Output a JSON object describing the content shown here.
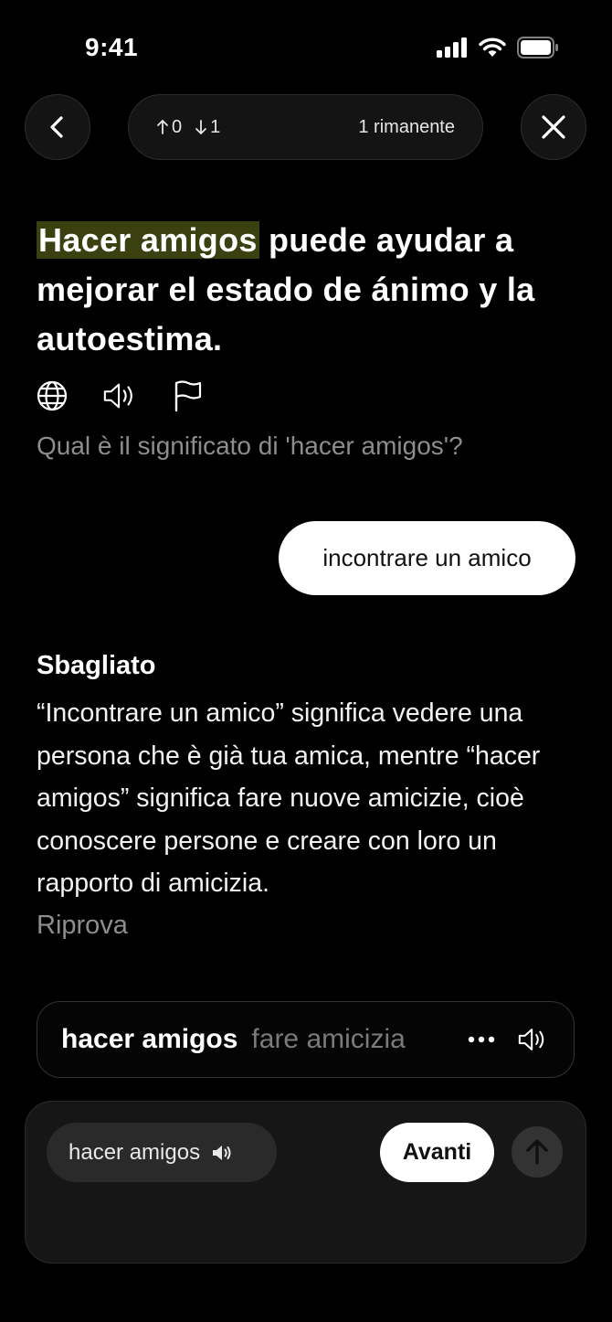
{
  "status_bar": {
    "time": "9:41"
  },
  "progress": {
    "up_count": "0",
    "down_count": "1",
    "remaining": "1 rimanente"
  },
  "sentence": {
    "highlight": "Hacer amigos",
    "rest": " puede ayudar a mejorar el estado de ánimo y la autoestima."
  },
  "question": "Qual è il significato di 'hacer amigos'?",
  "answer": "incontrare un amico",
  "feedback": {
    "title": "Sbagliato",
    "text": "“Incontrare un amico” significa vedere una persona che è già tua amica, mentre “hacer amigos” significa fare nuove amicizie, cioè conoscere persone e creare con loro un rapporto di amicizia.",
    "retry": "Riprova"
  },
  "vocab": {
    "word": "hacer amigos",
    "translation": "fare amicizia"
  },
  "bottom": {
    "chip_label": "hacer amigos",
    "next_label": "Avanti"
  },
  "icons": {
    "back": "chevron-left-icon",
    "close": "close-icon",
    "translate": "globe-icon",
    "audio": "speaker-icon",
    "report": "flag-icon",
    "more": "ellipsis-icon",
    "send": "arrow-up-icon"
  }
}
